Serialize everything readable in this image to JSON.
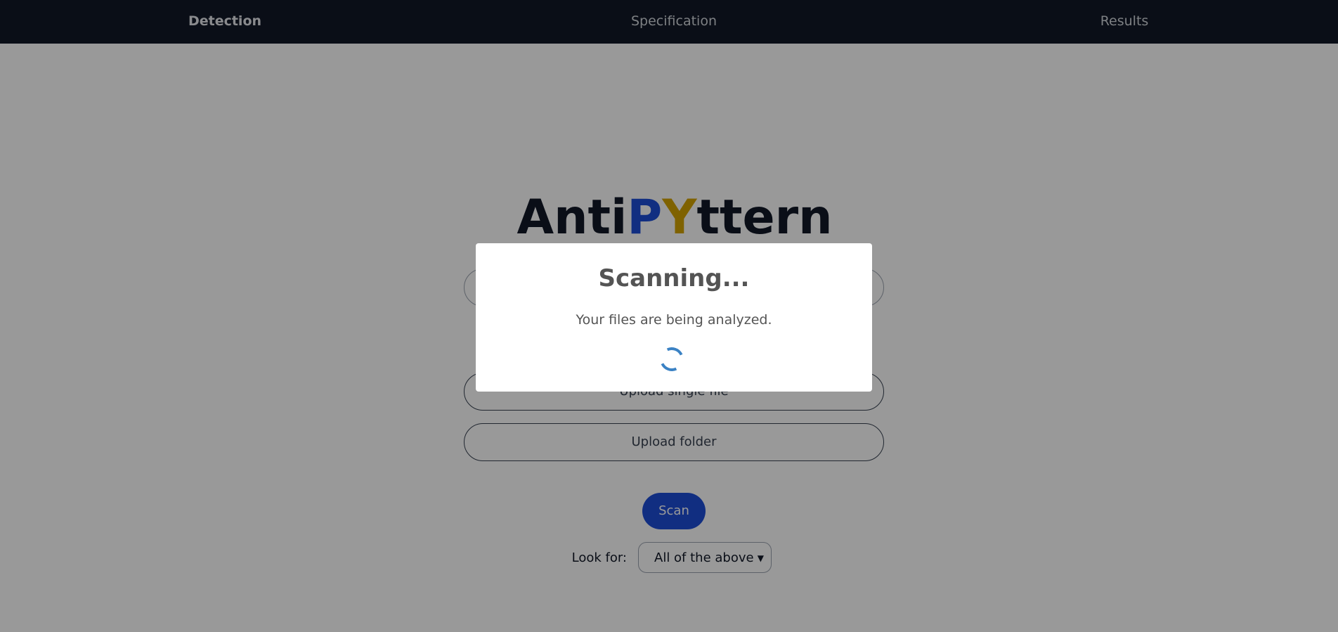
{
  "nav": {
    "items": [
      {
        "label": "Detection",
        "active": true
      },
      {
        "label": "Specification",
        "active": false
      },
      {
        "label": "Results",
        "active": false
      }
    ]
  },
  "logo": {
    "part1": "Anti",
    "part2": "P",
    "part3": "Y",
    "part4": "ttern"
  },
  "buttons": {
    "upload_single": "Upload single file",
    "upload_folder": "Upload folder",
    "scan": "Scan"
  },
  "lookfor": {
    "label": "Look for:",
    "selected": "All of the above"
  },
  "modal": {
    "title": "Scanning...",
    "text": "Your files are being analyzed."
  },
  "colors": {
    "navbar": "#111827",
    "accent_blue": "#1d4ed8",
    "accent_yellow": "#d4a300",
    "spinner": "#3b82c4"
  }
}
